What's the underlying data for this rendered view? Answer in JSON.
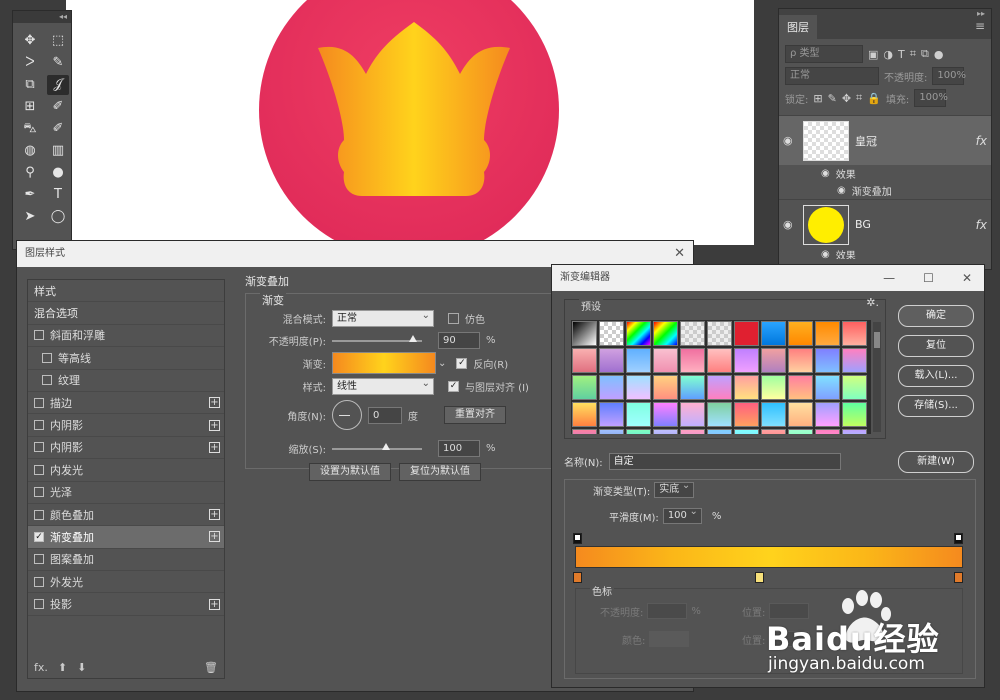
{
  "tools_panel": {
    "collapse": "◂◂",
    "tools": [
      "✥",
      "⬚",
      "ᐳ",
      "✎",
      "⧉",
      "𝒥",
      "⊞",
      "✐",
      "⛍",
      "✐",
      "◍",
      "▥",
      "⚲",
      "●",
      "✒",
      "T",
      "➤",
      "◯"
    ]
  },
  "layers_panel": {
    "collapse": "▸▸",
    "tab": "图层",
    "menu": "≡",
    "filter_placeholder": "ρ 类型",
    "blend_mode": "正常",
    "opacity_label": "不透明度:",
    "opacity_value": "100%",
    "lock_label": "锁定:",
    "fill_label": "填充:",
    "fill_value": "100%",
    "layers": [
      {
        "name": "皇冠",
        "fx": "fx",
        "effects_label": "效果",
        "effect": "渐变叠加"
      },
      {
        "name": "BG",
        "fx": "fx",
        "effects_label": "效果"
      }
    ]
  },
  "layer_style_dialog": {
    "title": "图层样式",
    "close": "✕",
    "styles_header": "样式",
    "blend_options": "混合选项",
    "items": [
      {
        "label": "斜面和浮雕",
        "checked": false,
        "plus": false,
        "indent": false
      },
      {
        "label": "等高线",
        "checked": false,
        "plus": false,
        "indent": true
      },
      {
        "label": "纹理",
        "checked": false,
        "plus": false,
        "indent": true
      },
      {
        "label": "描边",
        "checked": false,
        "plus": true,
        "indent": false
      },
      {
        "label": "内阴影",
        "checked": false,
        "plus": true,
        "indent": false
      },
      {
        "label": "内阴影",
        "checked": false,
        "plus": true,
        "indent": false
      },
      {
        "label": "内发光",
        "checked": false,
        "plus": false,
        "indent": false
      },
      {
        "label": "光泽",
        "checked": false,
        "plus": false,
        "indent": false
      },
      {
        "label": "颜色叠加",
        "checked": false,
        "plus": true,
        "indent": false
      },
      {
        "label": "渐变叠加",
        "checked": true,
        "plus": true,
        "indent": false
      },
      {
        "label": "图案叠加",
        "checked": false,
        "plus": false,
        "indent": false
      },
      {
        "label": "外发光",
        "checked": false,
        "plus": false,
        "indent": false
      },
      {
        "label": "投影",
        "checked": false,
        "plus": true,
        "indent": false
      }
    ],
    "bottom": {
      "fx": "fx.",
      "up": "⬆",
      "down": "⬇",
      "trash": "🗑"
    },
    "gradient_overlay": {
      "section": "渐变叠加",
      "subsection": "渐变",
      "blend_mode_label": "混合模式:",
      "blend_mode": "正常",
      "dither_label": "仿色",
      "opacity_label": "不透明度(P):",
      "opacity_value": "90",
      "opacity_level": 0.9,
      "percent": "%",
      "gradient_label": "渐变:",
      "reverse_label": "反向(R)",
      "style_label": "样式:",
      "style_value": "线性",
      "align_label": "与图层对齐 (I)",
      "angle_label": "角度(N):",
      "angle_value": "0",
      "degree": "度",
      "reset_align": "重置对齐",
      "scale_label": "缩放(S):",
      "scale_value": "100",
      "scale_level": 0.6,
      "make_default": "设置为默认值",
      "reset_default": "复位为默认值"
    }
  },
  "gradient_editor": {
    "title": "渐变编辑器",
    "minimize": "—",
    "maximize": "☐",
    "close": "✕",
    "presets_label": "预设",
    "gear": "✲.",
    "buttons": {
      "ok": "确定",
      "reset": "复位",
      "load": "载入(L)...",
      "save": "存储(S)...",
      "new": "新建(W)"
    },
    "name_label": "名称(N):",
    "name_value": "自定",
    "gradient_type_label": "渐变类型(T):",
    "gradient_type": "实底",
    "smoothness_label": "平滑度(M):",
    "smoothness_value": "100",
    "percent": "%",
    "color_stops_label": "色标",
    "stop_opacity_label": "不透明度:",
    "stop_location_label": "位置:",
    "stop_color_label": "颜色:",
    "stop_location_label2": "位置:",
    "gradient_colors": {
      "end": "#f58a1e",
      "mid": "#ffd31c"
    },
    "swatches": [
      "linear-gradient(135deg,#000,#fff)",
      "repeating-conic-gradient(#ccc 0 25%,#fff 0 50%) 0 0/8px 8px",
      "linear-gradient(135deg,#f00,#ff0,#0f0,#0ff,#00f,#f0f)",
      "linear-gradient(135deg,#f00,#ff0,#0f0,#0ff,#00f)",
      "repeating-conic-gradient(#ccc 0 25%,#eee 0 50%) 0 0/8px 8px",
      "repeating-conic-gradient(#ccc 0 25%,#eee 0 50%) 0 0/8px 8px",
      "#e02030",
      "linear-gradient(#2aa4ff,#0077dd)",
      "linear-gradient(#ffb020,#ff8800)",
      "linear-gradient(#ff8a00,#ffaa40)",
      "linear-gradient(#ff6060,#ffb0a0)",
      "linear-gradient(#f9b0b0,#e07080)",
      "linear-gradient(#d0a0e0,#a070d0)",
      "linear-gradient(#60b0ff,#a0d0ff)",
      "linear-gradient(#f9c0d0,#f090b0)",
      "linear-gradient(#f070a0,#ffb0c0)",
      "linear-gradient(#ffc0c0,#ff8080)",
      "linear-gradient(#c080ff,#f0a0ff)",
      "linear-gradient(#f0a0a0,#b080c0)",
      "linear-gradient(#ff8080,#ffd0a0)",
      "linear-gradient(#8080ff,#80c0ff)",
      "linear-gradient(#ff80c0,#a0a0ff)",
      "linear-gradient(#a0f080,#60d0a0)",
      "linear-gradient(#80c0ff,#c0a0ff)",
      "linear-gradient(#a0e0ff,#f0c0ff)",
      "linear-gradient(#ffd080,#ff9080)",
      "linear-gradient(#80ffd0,#60a0ff)",
      "linear-gradient(#c0a0ff,#ff80c0)",
      "linear-gradient(#ffa0a0,#ffe080)",
      "linear-gradient(#a0ffa0,#ffffa0)",
      "linear-gradient(#ff80a0,#ffc080)",
      "linear-gradient(#80e0ff,#80a0ff)",
      "linear-gradient(#d0ff80,#80ffc0)",
      "linear-gradient(#ffe060,#ff8040)",
      "linear-gradient(#6080ff,#c0a0ff)",
      "linear-gradient(#80ffe0,#a0ffff)",
      "linear-gradient(#ff80ff,#8080ff)",
      "linear-gradient(#ffb0d0,#c0b0ff)",
      "linear-gradient(#80d0a0,#a0e0ff)",
      "linear-gradient(#ff6080,#ffa060)",
      "linear-gradient(#30c0ff,#80e0ff)",
      "linear-gradient(#ffe0a0,#ffb080)",
      "linear-gradient(#a0a0ff,#ffa0ff)",
      "linear-gradient(#60ffa0,#c0ff60)",
      "linear-gradient(#ff80a0,#8080ff)",
      "linear-gradient(#a0c0ff,#6080c0)",
      "linear-gradient(#80ffc0,#40c0ff)",
      "linear-gradient(#c0c0ff,#8080e0)",
      "linear-gradient(#ffa0c0,#c080ff)",
      "linear-gradient(#80d0ff,#a0a0ff)",
      "linear-gradient(#80ffff,#80c0ff)",
      "linear-gradient(#ffa0a0,#ff6060)",
      "linear-gradient(#a0ffd0,#60ffa0)",
      "linear-gradient(#ff80c0,#ffa0ff)",
      "linear-gradient(#c0a0ff,#80ffff)"
    ]
  },
  "watermark": {
    "logo": "Baidu经验",
    "url": "jingyan.baidu.com"
  }
}
